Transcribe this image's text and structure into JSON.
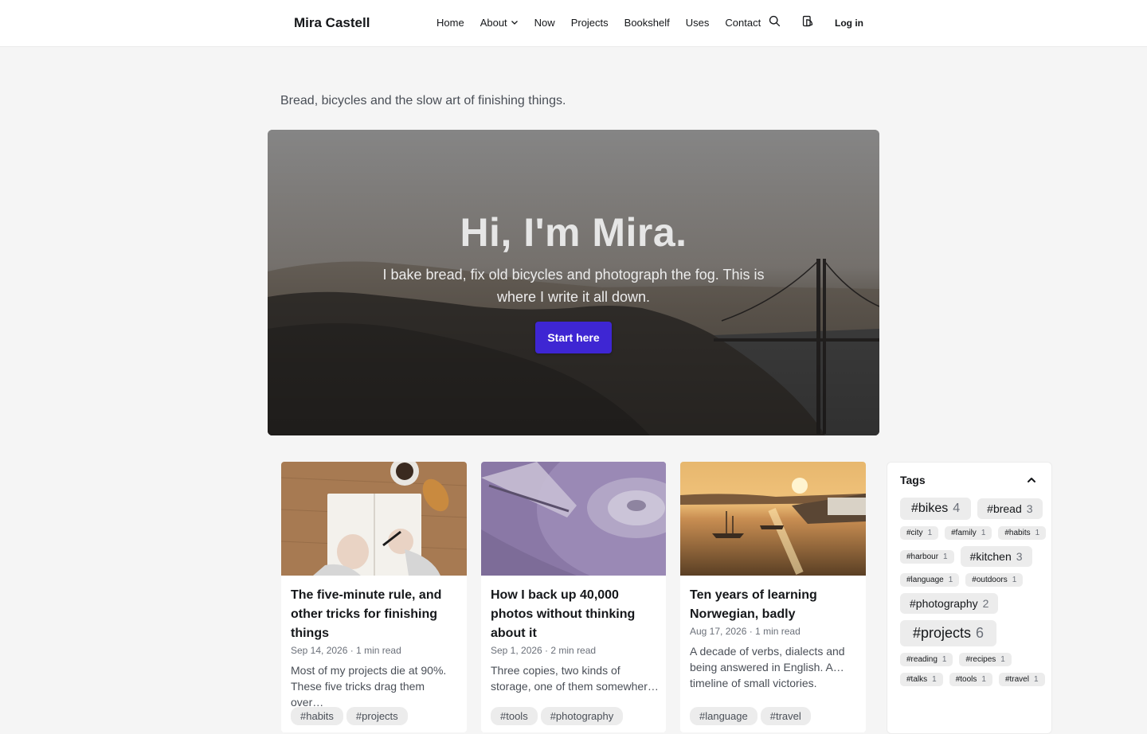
{
  "header": {
    "brand": "Mira Castell",
    "nav": [
      "Home",
      "About",
      "Now",
      "Projects",
      "Bookshelf",
      "Uses",
      "Contact"
    ],
    "login": "Log in"
  },
  "tagline": "Bread, bicycles and the slow art of finishing things.",
  "hero": {
    "title": "Hi, I'm Mira.",
    "subtitle": "I bake bread, fix old bicycles and photograph the fog. This is where I write it all down.",
    "cta": "Start here"
  },
  "cards": [
    {
      "title": "The five-minute rule, and other tricks for finishing things",
      "meta": "Sep 14, 2026 · 1 min read",
      "excerpt": "Most of my projects die at 90%. These five tricks drag them over…",
      "tags": [
        "#habits",
        "#projects"
      ]
    },
    {
      "title": "How I back up 40,000 photos without thinking about it",
      "meta": "Sep 1, 2026 · 2 min read",
      "excerpt": "Three copies, two kinds of storage, one of them somewher…",
      "tags": [
        "#tools",
        "#photography"
      ]
    },
    {
      "title": "Ten years of learning Norwegian, badly",
      "meta": "Aug 17, 2026 · 1 min read",
      "excerpt": "A decade of verbs, dialects and being answered in English. A… timeline of small victories.",
      "tags": [
        "#language",
        "#travel"
      ]
    }
  ],
  "tags_widget": {
    "title": "Tags",
    "tags": [
      {
        "name": "#bikes",
        "count": "4"
      },
      {
        "name": "#bread",
        "count": "3"
      },
      {
        "name": "#city",
        "count": "1"
      },
      {
        "name": "#family",
        "count": "1"
      },
      {
        "name": "#habits",
        "count": "1"
      },
      {
        "name": "#harbour",
        "count": "1"
      },
      {
        "name": "#kitchen",
        "count": "3"
      },
      {
        "name": "#language",
        "count": "1"
      },
      {
        "name": "#outdoors",
        "count": "1"
      },
      {
        "name": "#photography",
        "count": "2"
      },
      {
        "name": "#projects",
        "count": "6"
      },
      {
        "name": "#reading",
        "count": "1"
      },
      {
        "name": "#recipes",
        "count": "1"
      },
      {
        "name": "#talks",
        "count": "1"
      },
      {
        "name": "#tools",
        "count": "1"
      },
      {
        "name": "#travel",
        "count": "1"
      }
    ]
  },
  "colors": {
    "accent": "#3e26d3",
    "background": "#f5f5f5",
    "text": "#15171a"
  },
  "icons": [
    "search-icon",
    "theme-toggle-icon",
    "chevron-down-icon",
    "chevron-up-icon"
  ]
}
